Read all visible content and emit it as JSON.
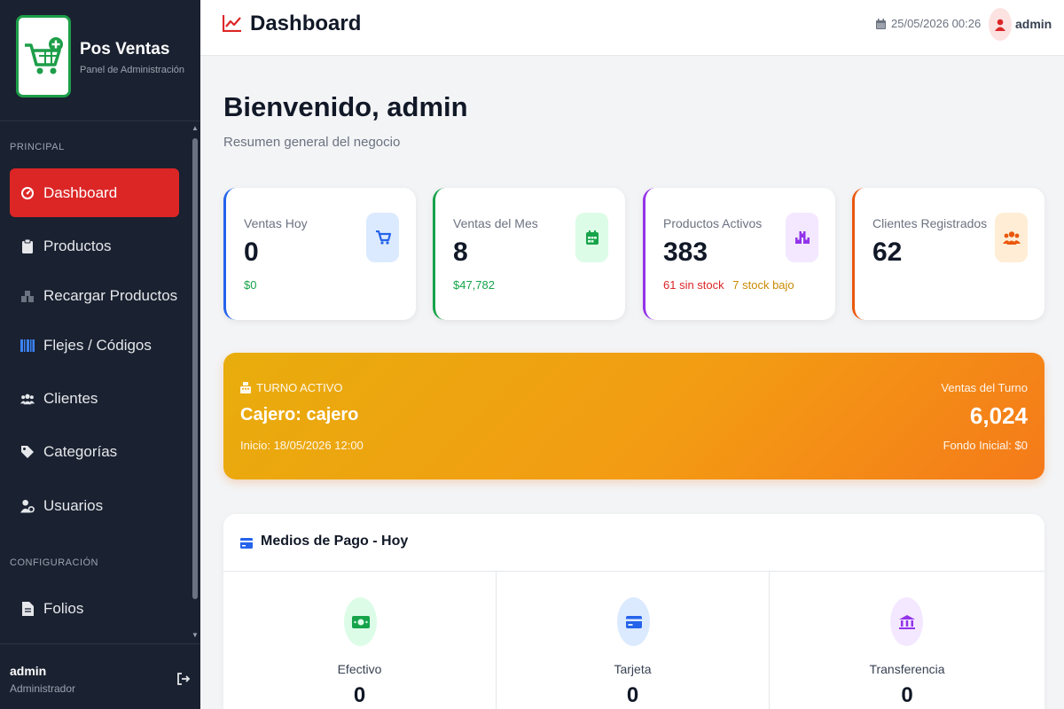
{
  "brand": {
    "title": "Pos Ventas",
    "subtitle": "Panel de Administración",
    "logo_icon": "shopping-cart-plus-icon"
  },
  "sidebar": {
    "section_principal": "PRINCIPAL",
    "section_config": "CONFIGURACIÓN",
    "items": [
      {
        "label": "Dashboard",
        "icon": "dashboard-gauge-icon",
        "active": true
      },
      {
        "label": "Productos",
        "icon": "clipboard-icon",
        "active": false
      },
      {
        "label": "Recargar Productos",
        "icon": "boxes-icon",
        "active": false
      },
      {
        "label": "Flejes / Códigos",
        "icon": "barcode-icon",
        "active": false
      },
      {
        "label": "Clientes",
        "icon": "users-icon",
        "active": false
      },
      {
        "label": "Categorías",
        "icon": "tags-icon",
        "active": false
      },
      {
        "label": "Usuarios",
        "icon": "user-gear-icon",
        "active": false
      }
    ],
    "config_items": [
      {
        "label": "Folios",
        "icon": "file-icon"
      }
    ],
    "user": {
      "name": "admin",
      "role": "Administrador"
    }
  },
  "header": {
    "title": "Dashboard",
    "datetime": "25/05/2026 00:26",
    "user": "admin"
  },
  "main": {
    "welcome": "Bienvenido, admin",
    "subtitle": "Resumen general del negocio"
  },
  "cards": [
    {
      "label": "Ventas Hoy",
      "value": "0",
      "sub": "$0",
      "sub_color": "#16a34a",
      "accent": "#2563eb",
      "icon": "cart-icon"
    },
    {
      "label": "Ventas del Mes",
      "value": "8",
      "sub": "$47,782",
      "sub_color": "#16a34a",
      "accent": "#16a34a",
      "icon": "calendar-icon"
    },
    {
      "label": "Productos Activos",
      "value": "383",
      "sub_a": "61 sin stock",
      "sub_b": "7 stock bajo",
      "accent": "#9333ea",
      "icon": "boxes-icon"
    },
    {
      "label": "Clientes Registrados",
      "value": "62",
      "accent": "#ea580c",
      "icon": "users-icon"
    }
  ],
  "shift": {
    "tag": "TURNO ACTIVO",
    "cashier": "Cajero: cajero",
    "start": "Inicio: 18/05/2026 12:00",
    "sales_label": "Ventas del Turno",
    "sales_value": "6,024",
    "fund": "Fondo Inicial: $0"
  },
  "payments": {
    "title": "Medios de Pago - Hoy",
    "methods": [
      {
        "label": "Efectivo",
        "value": "0",
        "icon": "cash-icon"
      },
      {
        "label": "Tarjeta",
        "value": "0",
        "icon": "credit-card-icon"
      },
      {
        "label": "Transferencia",
        "value": "0",
        "icon": "bank-icon"
      }
    ]
  }
}
